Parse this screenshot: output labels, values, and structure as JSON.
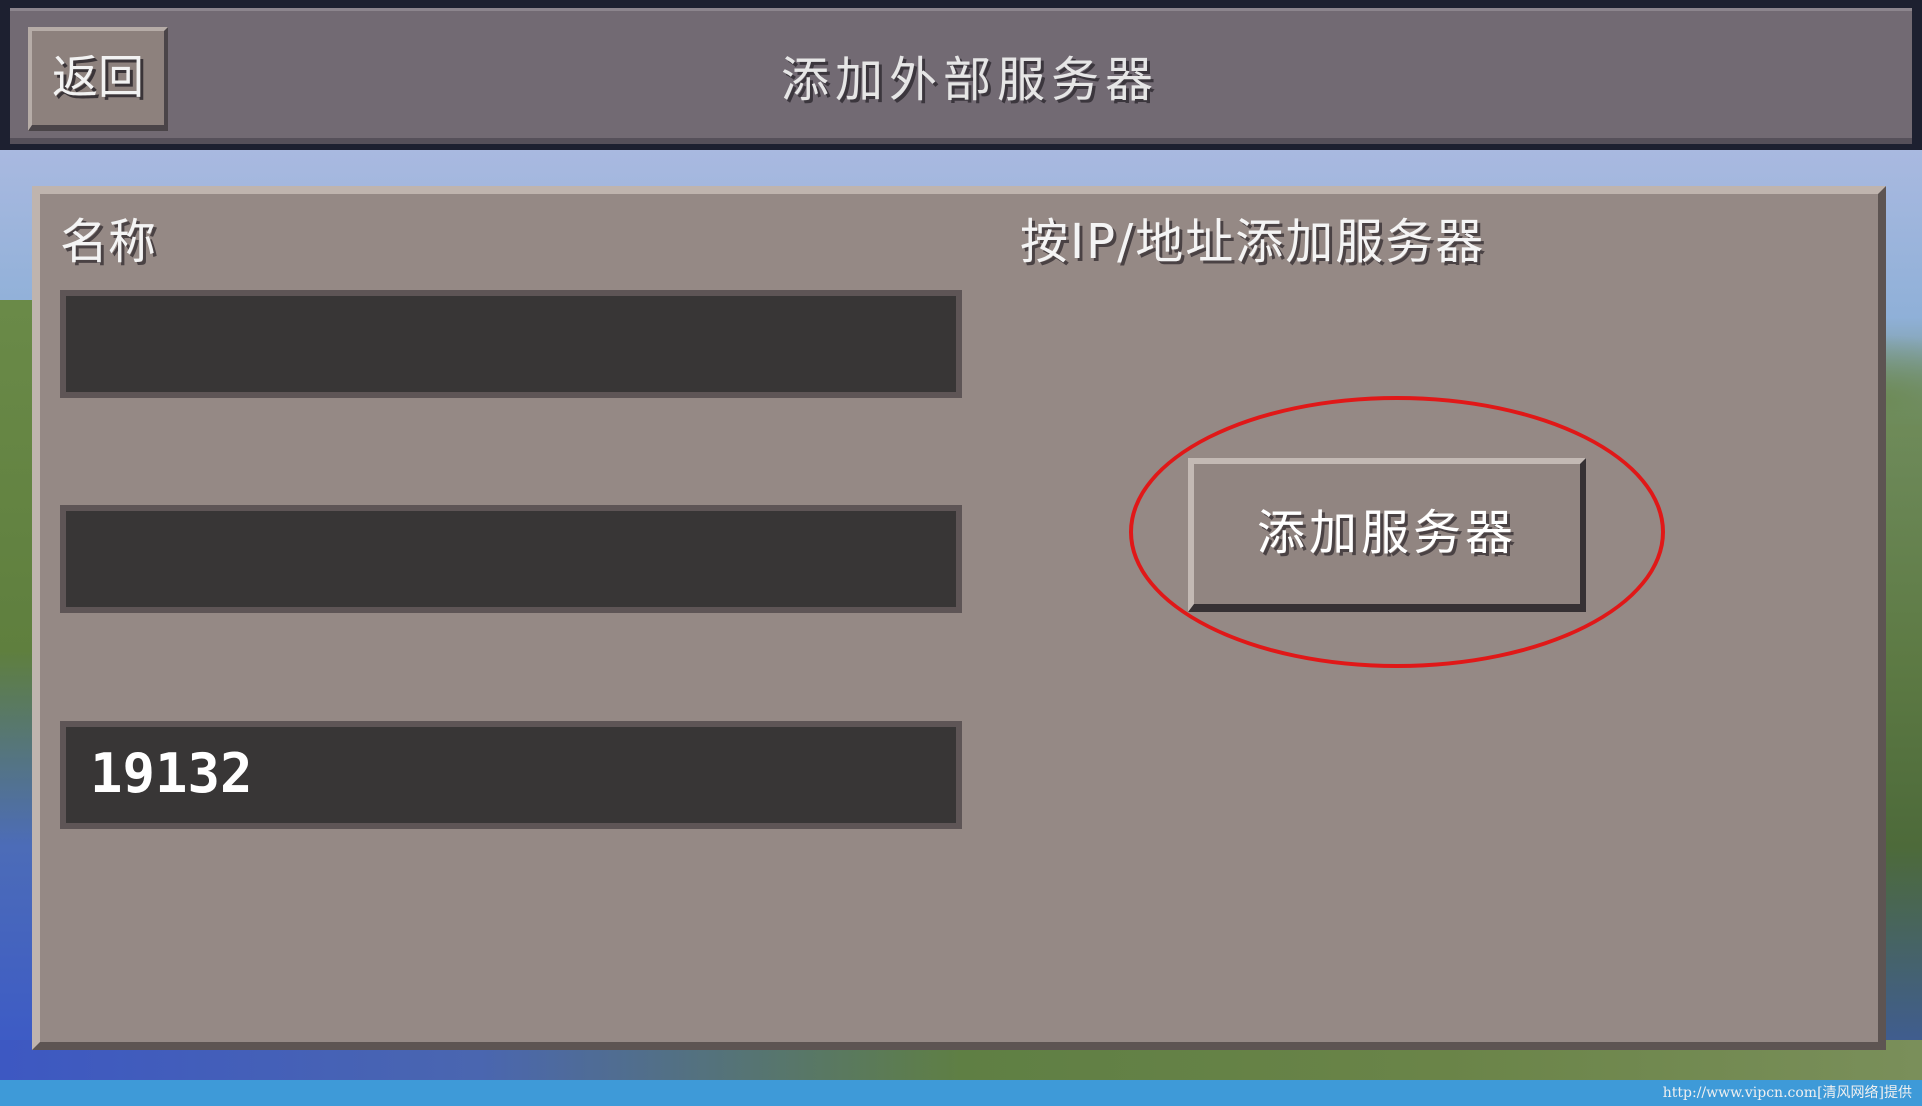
{
  "header": {
    "back_label": "返回",
    "title": "添加外部服务器"
  },
  "form": {
    "name_label": "名称",
    "name_value": "",
    "address_value": "",
    "port_value": "19132"
  },
  "right_section": {
    "label": "按IP/地址添加服务器",
    "add_button_label": "添加服务器"
  },
  "watermark": {
    "text": "http://www.vipcn.com[清风网络]提供"
  },
  "colors": {
    "panel": "#958985",
    "header": "#726a73",
    "field": "#383636",
    "highlight": "#e01818",
    "footer": "#3e9ad8"
  }
}
